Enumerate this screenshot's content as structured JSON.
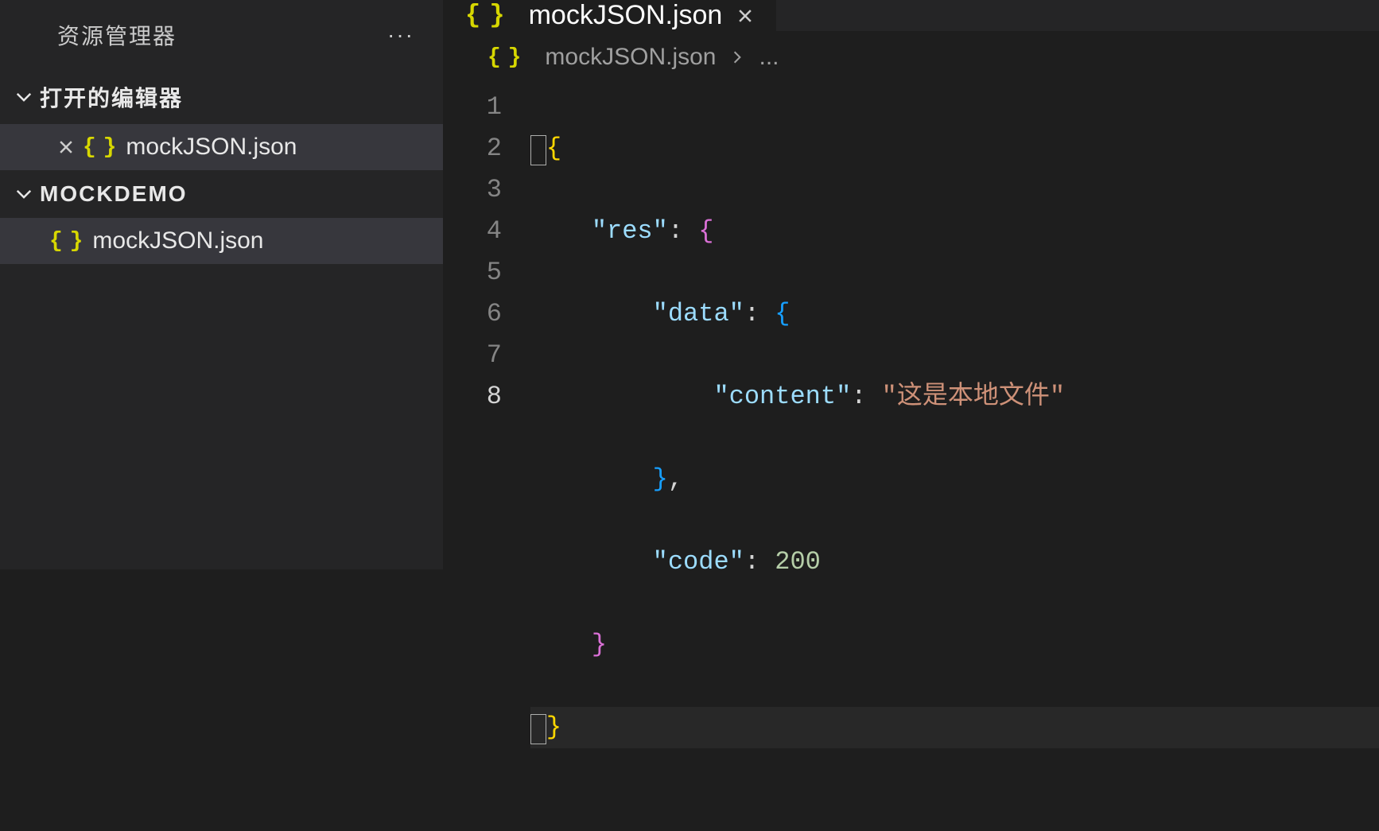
{
  "sidebar": {
    "title": "资源管理器",
    "sections": {
      "openEditors": {
        "label": "打开的编辑器",
        "items": [
          {
            "name": "mockJSON.json",
            "icon": "json-icon"
          }
        ]
      },
      "workspace": {
        "label": "MOCKDEMO",
        "items": [
          {
            "name": "mockJSON.json",
            "icon": "json-icon"
          }
        ]
      }
    }
  },
  "tabs": [
    {
      "label": "mockJSON.json",
      "icon": "json-icon",
      "active": true
    }
  ],
  "breadcrumb": {
    "file": "mockJSON.json",
    "rest": "..."
  },
  "code": {
    "lineNumbers": [
      "1",
      "2",
      "3",
      "4",
      "5",
      "6",
      "7",
      "8"
    ],
    "activeLine": 8,
    "tokens": {
      "l2_key": "\"res\"",
      "l3_key": "\"data\"",
      "l4_key": "\"content\"",
      "l4_val": "\"这是本地文件\"",
      "l6_key": "\"code\"",
      "l6_val": "200"
    },
    "jsonSource": {
      "res": {
        "data": {
          "content": "这是本地文件"
        },
        "code": 200
      }
    }
  },
  "icons": {
    "jsonGlyph": "{ }"
  }
}
